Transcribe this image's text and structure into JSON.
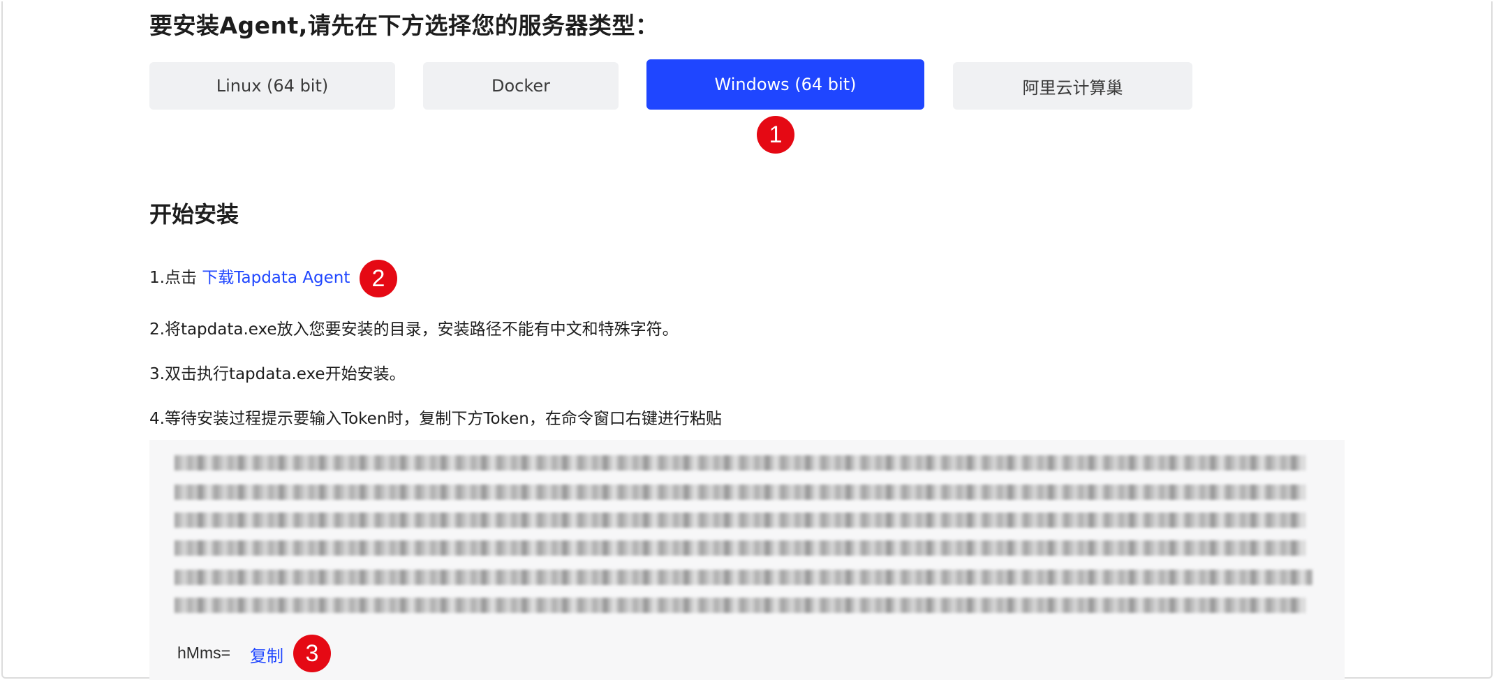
{
  "heading": "要安装Agent,请先在下方选择您的服务器类型：",
  "server_types": [
    {
      "label": "Linux (64 bit)",
      "active": false
    },
    {
      "label": "Docker",
      "active": false
    },
    {
      "label": "Windows (64 bit)",
      "active": true
    },
    {
      "label": "阿里云计算巢",
      "active": false
    }
  ],
  "section_title": "开始安装",
  "steps": {
    "step1_prefix": "1.点击 ",
    "step1_link": "下载Tapdata Agent",
    "step2": "2.将tapdata.exe放入您要安装的目录，安装路径不能有中文和特殊字符。",
    "step3": "3.双击执行tapdata.exe开始安装。",
    "step4": "4.等待安装过程提示要输入Token时，复制下方Token，在命令窗口右键进行粘贴"
  },
  "token": {
    "visible_tail": "hMms=",
    "copy_label": "复制"
  },
  "annotations": [
    "1",
    "2",
    "3"
  ],
  "colors": {
    "primary": "#1f46ff",
    "tab_bg": "#f0f1f3",
    "badge": "#e50914",
    "token_bg": "#f7f7f8"
  }
}
